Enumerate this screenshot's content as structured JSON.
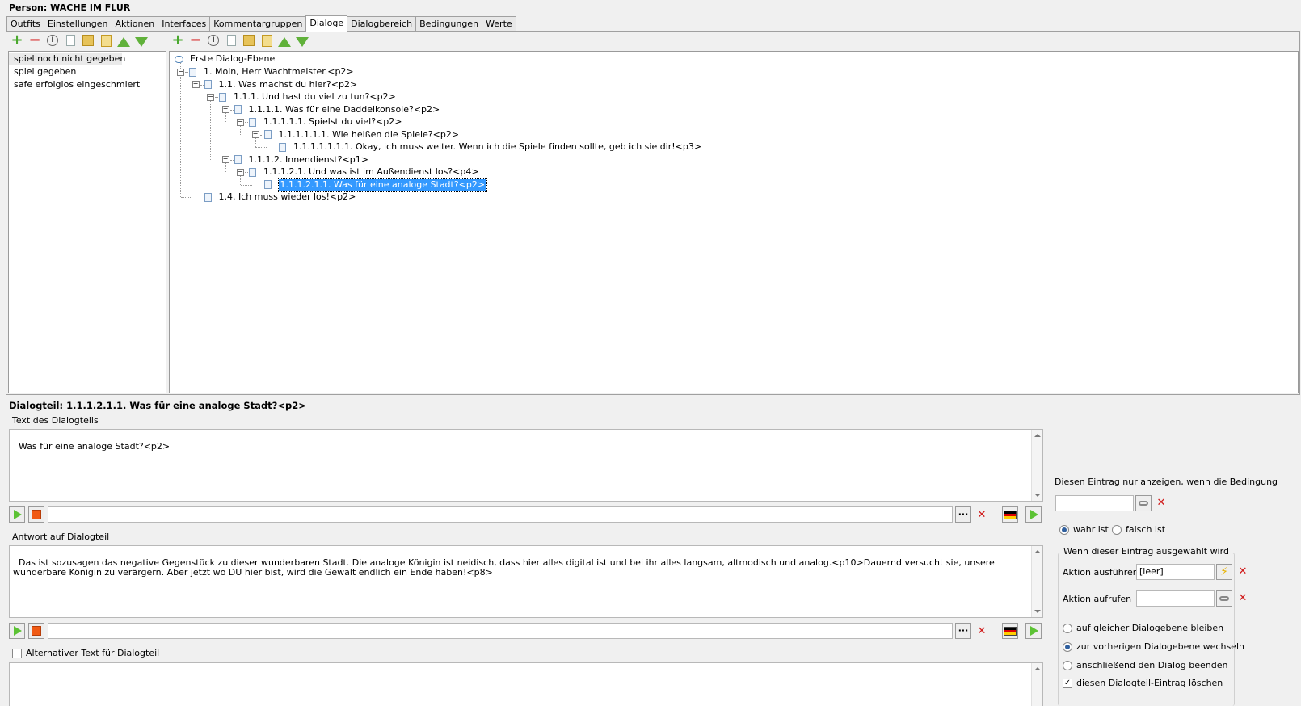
{
  "window": {
    "title": "Person: WACHE IM FLUR"
  },
  "tabs": [
    {
      "label": "Outfits"
    },
    {
      "label": "Einstellungen"
    },
    {
      "label": "Aktionen"
    },
    {
      "label": "Interfaces"
    },
    {
      "label": "Kommentargruppen"
    },
    {
      "label": "Dialoge",
      "active": true
    },
    {
      "label": "Dialogbereich"
    },
    {
      "label": "Bedingungen"
    },
    {
      "label": "Werte"
    }
  ],
  "dialog_list": {
    "items": [
      {
        "label": "spiel noch nicht gegeben",
        "selected": true
      },
      {
        "label": "spiel gegeben"
      },
      {
        "label": "safe erfolglos eingeschmiert"
      }
    ]
  },
  "tree": {
    "root": "Erste Dialog-Ebene",
    "nodes": [
      {
        "label": "1. Moin, Herr Wachtmeister.<p2>",
        "depth": 0,
        "expanded": true
      },
      {
        "label": "1.1. Was machst du hier?<p2>",
        "depth": 1,
        "expanded": true
      },
      {
        "label": "1.1.1. Und hast du viel zu tun?<p2>",
        "depth": 2,
        "expanded": true
      },
      {
        "label": "1.1.1.1. Was für eine Daddelkonsole?<p2>",
        "depth": 3,
        "expanded": true
      },
      {
        "label": "1.1.1.1.1. Spielst du viel?<p2>",
        "depth": 4,
        "expanded": true
      },
      {
        "label": "1.1.1.1.1.1. Wie heißen die Spiele?<p2>",
        "depth": 5,
        "expanded": true
      },
      {
        "label": "1.1.1.1.1.1.1. Okay, ich muss weiter. Wenn ich die Spiele finden sollte, geb ich sie dir!<p3>",
        "depth": 6,
        "leaf": true
      },
      {
        "label": "1.1.1.2. Innendienst?<p1>",
        "depth": 3,
        "expanded": true
      },
      {
        "label": "1.1.1.2.1. Und was ist im Außendienst los?<p4>",
        "depth": 4,
        "expanded": true
      },
      {
        "label": "1.1.1.2.1.1. Was für eine analoge Stadt?<p2>",
        "depth": 5,
        "leaf": true,
        "selected": true
      },
      {
        "label": "1.4. Ich muss wieder los!<p2>",
        "depth": 1,
        "leaf": true
      }
    ]
  },
  "detail": {
    "heading": "Dialogteil: 1.1.1.2.1.1. Was für eine analoge Stadt?<p2>",
    "text_label": "Text des Dialogteils",
    "text_value": "Was für eine analoge Stadt?<p2>",
    "answer_label": "Antwort auf Dialogteil",
    "answer_value": "Das ist sozusagen das negative Gegenstück zu dieser wunderbaren Stadt. Die analoge Königin ist neidisch, dass hier alles digital ist und bei ihr alles langsam, altmodisch und analog.<p10>Dauernd versucht sie, unsere wunderbare Königin zu verärgern. Aber jetzt wo DU hier bist, wird die Gewalt endlich ein Ende haben!<p8>",
    "alt_label": "Alternativer Text für Dialogteil",
    "audio_file_1": "",
    "audio_file_2": "",
    "alt_value": ""
  },
  "condition": {
    "label": "Diesen Eintrag nur anzeigen, wenn die Bedingung",
    "value": "",
    "true_label": "wahr ist",
    "false_label": "falsch ist"
  },
  "selection": {
    "group_label": "Wenn dieser Eintrag ausgewählt wird",
    "action_run_label": "Aktion ausführen",
    "action_run_value": "[leer]",
    "action_call_label": "Aktion aufrufen",
    "action_call_value": "",
    "opt_same": "auf gleicher Dialogebene bleiben",
    "opt_prev": "zur vorherigen Dialogebene wechseln",
    "opt_end": "anschließend den Dialog beenden",
    "opt_delete": "diesen Dialogteil-Eintrag löschen"
  },
  "colors": {
    "selection": "#3399ff",
    "accent_green": "#5cc234",
    "stop_orange": "#f05a14",
    "delete_red": "#d01818"
  },
  "icons": {
    "toolbar": [
      "add-icon",
      "remove-icon",
      "rename-icon",
      "edit-icon",
      "copy-icon",
      "paste-icon",
      "move-up-icon",
      "move-down-icon"
    ],
    "media": [
      "play-icon",
      "stop-icon",
      "browse-icon",
      "clear-icon",
      "german-flag-icon"
    ],
    "condition": [
      "link-icon",
      "clear-icon"
    ],
    "action": [
      "lightning-icon",
      "link-icon",
      "clear-icon"
    ]
  }
}
